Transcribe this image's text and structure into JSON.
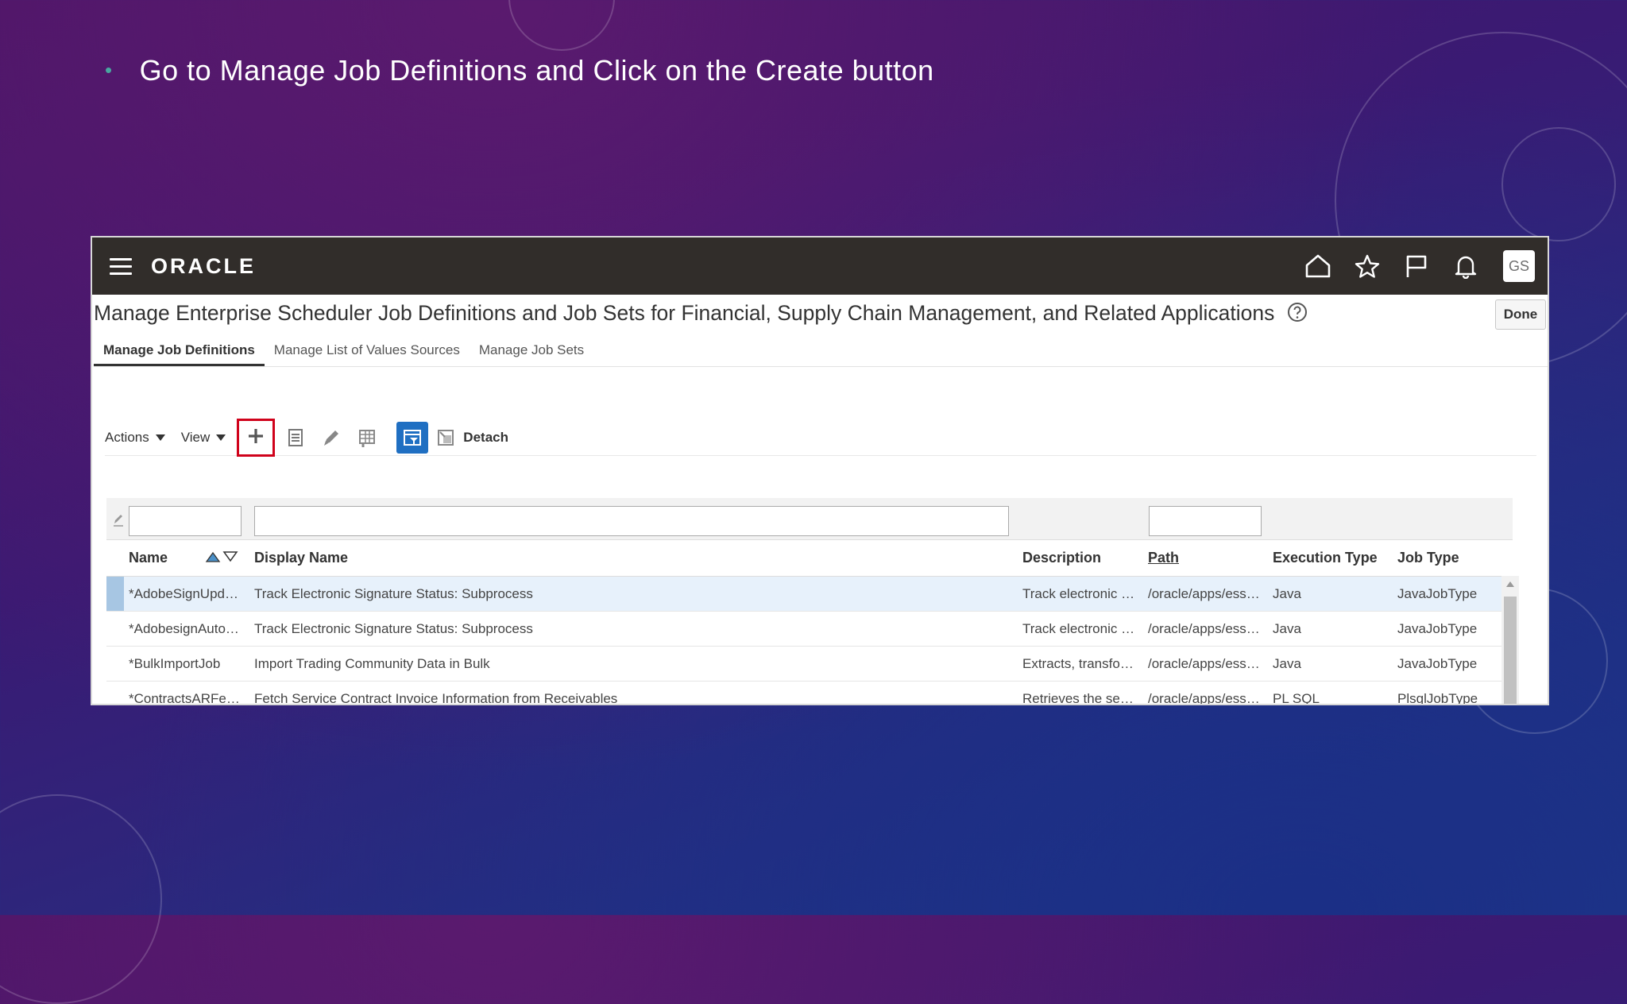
{
  "slide": {
    "bullet_text": "Go to Manage Job Definitions and Click on the Create button"
  },
  "topbar": {
    "logo": "ORACLE",
    "icons": [
      "home-icon",
      "star-icon",
      "flag-icon",
      "bell-icon"
    ],
    "avatar_initials": "GS"
  },
  "page": {
    "title": "Manage Enterprise Scheduler Job Definitions and Job Sets for Financial, Supply Chain Management, and Related Applications",
    "done_label": "Done"
  },
  "tabs": [
    {
      "label": "Manage Job Definitions",
      "active": true
    },
    {
      "label": "Manage List of Values Sources",
      "active": false
    },
    {
      "label": "Manage Job Sets",
      "active": false
    }
  ],
  "toolbar": {
    "actions_label": "Actions",
    "view_label": "View",
    "detach_label": "Detach",
    "highlight_color": "#d0021b",
    "accent_color": "#1f6fc2"
  },
  "table": {
    "columns": [
      "Name",
      "Display Name",
      "Description",
      "Path",
      "Execution Type",
      "Job Type"
    ],
    "rows": [
      {
        "name": "*AdobeSignUpd…",
        "display_name": "Track Electronic Signature Status: Subprocess",
        "description": "Track electronic …",
        "path": "/oracle/apps/ess…",
        "execution_type": "Java",
        "job_type": "JavaJobType"
      },
      {
        "name": "*AdobesignAuto…",
        "display_name": "Track Electronic Signature Status: Subprocess",
        "description": "Track electronic …",
        "path": "/oracle/apps/ess…",
        "execution_type": "Java",
        "job_type": "JavaJobType"
      },
      {
        "name": "*BulkImportJob",
        "display_name": "Import Trading Community Data in Bulk",
        "description": "Extracts, transfo…",
        "path": "/oracle/apps/ess…",
        "execution_type": "Java",
        "job_type": "JavaJobType"
      },
      {
        "name": "*ContractsARFe…",
        "display_name": "Fetch Service Contract Invoice Information from Receivables",
        "description": "Retrieves the se…",
        "path": "/oracle/apps/ess…",
        "execution_type": "PL SQL",
        "job_type": "PlsqlJobType"
      }
    ]
  }
}
